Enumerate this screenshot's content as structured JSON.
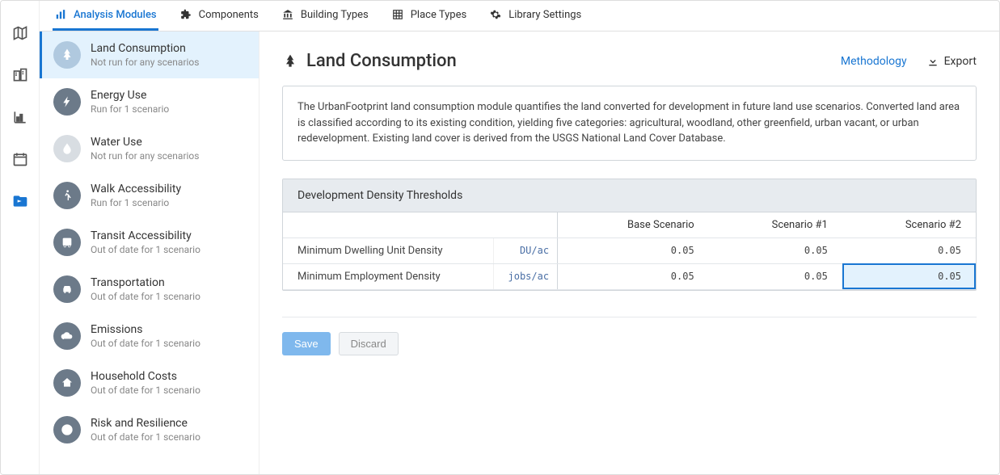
{
  "tabs": [
    {
      "label": "Analysis Modules"
    },
    {
      "label": "Components"
    },
    {
      "label": "Building Types"
    },
    {
      "label": "Place Types"
    },
    {
      "label": "Library Settings"
    }
  ],
  "modules": [
    {
      "title": "Land Consumption",
      "sub": "Not run for any scenarios"
    },
    {
      "title": "Energy Use",
      "sub": "Run for 1 scenario"
    },
    {
      "title": "Water Use",
      "sub": "Not run for any scenarios"
    },
    {
      "title": "Walk Accessibility",
      "sub": "Run for 1 scenario"
    },
    {
      "title": "Transit Accessibility",
      "sub": "Out of date for 1 scenario"
    },
    {
      "title": "Transportation",
      "sub": "Out of date for 1 scenario"
    },
    {
      "title": "Emissions",
      "sub": "Out of date for 1 scenario"
    },
    {
      "title": "Household Costs",
      "sub": "Out of date for 1 scenario"
    },
    {
      "title": "Risk and Resilience",
      "sub": "Out of date for 1 scenario"
    }
  ],
  "detail": {
    "title": "Land Consumption",
    "methodology": "Methodology",
    "export": "Export",
    "description": "The UrbanFootprint land consumption module quantifies the land converted for development in future land use scenarios. Converted land area is classified according to its existing condition, yielding five categories: agricultural, woodland, other greenfield, urban vacant, or urban redevelopment. Existing land cover is derived from the USGS National Land Cover Database.",
    "grid": {
      "caption": "Development Density Thresholds",
      "headers": [
        "",
        "Base Scenario",
        "Scenario #1",
        "Scenario #2"
      ],
      "rows": [
        {
          "label": "Minimum Dwelling Unit Density",
          "unit": "DU/ac",
          "vals": [
            "0.05",
            "0.05",
            "0.05"
          ]
        },
        {
          "label": "Minimum Employment Density",
          "unit": "jobs/ac",
          "vals": [
            "0.05",
            "0.05",
            "0.05"
          ]
        }
      ]
    },
    "save": "Save",
    "discard": "Discard"
  }
}
